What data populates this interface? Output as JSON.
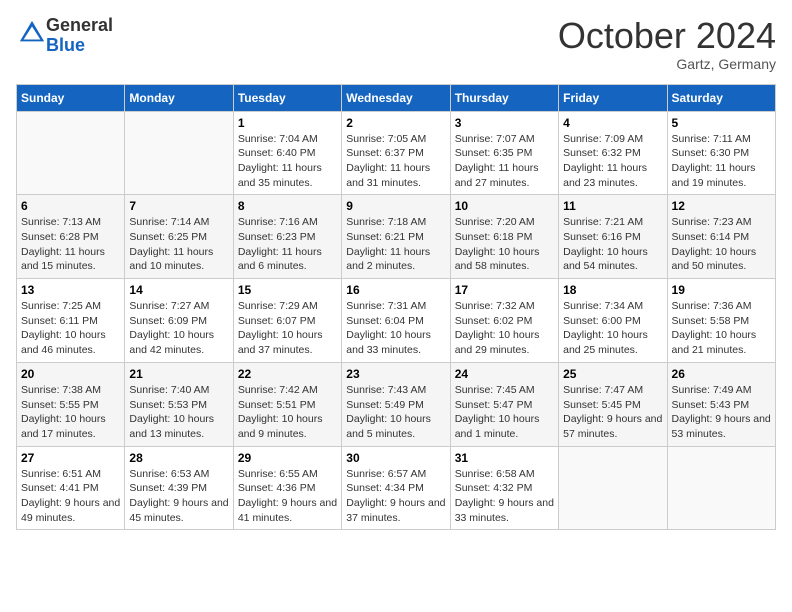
{
  "header": {
    "logo": {
      "general": "General",
      "blue": "Blue"
    },
    "title": "October 2024",
    "location": "Gartz, Germany"
  },
  "weekdays": [
    "Sunday",
    "Monday",
    "Tuesday",
    "Wednesday",
    "Thursday",
    "Friday",
    "Saturday"
  ],
  "weeks": [
    [
      {
        "day": "",
        "empty": true
      },
      {
        "day": "",
        "empty": true
      },
      {
        "day": "1",
        "sunrise": "Sunrise: 7:04 AM",
        "sunset": "Sunset: 6:40 PM",
        "daylight": "Daylight: 11 hours and 35 minutes."
      },
      {
        "day": "2",
        "sunrise": "Sunrise: 7:05 AM",
        "sunset": "Sunset: 6:37 PM",
        "daylight": "Daylight: 11 hours and 31 minutes."
      },
      {
        "day": "3",
        "sunrise": "Sunrise: 7:07 AM",
        "sunset": "Sunset: 6:35 PM",
        "daylight": "Daylight: 11 hours and 27 minutes."
      },
      {
        "day": "4",
        "sunrise": "Sunrise: 7:09 AM",
        "sunset": "Sunset: 6:32 PM",
        "daylight": "Daylight: 11 hours and 23 minutes."
      },
      {
        "day": "5",
        "sunrise": "Sunrise: 7:11 AM",
        "sunset": "Sunset: 6:30 PM",
        "daylight": "Daylight: 11 hours and 19 minutes."
      }
    ],
    [
      {
        "day": "6",
        "sunrise": "Sunrise: 7:13 AM",
        "sunset": "Sunset: 6:28 PM",
        "daylight": "Daylight: 11 hours and 15 minutes."
      },
      {
        "day": "7",
        "sunrise": "Sunrise: 7:14 AM",
        "sunset": "Sunset: 6:25 PM",
        "daylight": "Daylight: 11 hours and 10 minutes."
      },
      {
        "day": "8",
        "sunrise": "Sunrise: 7:16 AM",
        "sunset": "Sunset: 6:23 PM",
        "daylight": "Daylight: 11 hours and 6 minutes."
      },
      {
        "day": "9",
        "sunrise": "Sunrise: 7:18 AM",
        "sunset": "Sunset: 6:21 PM",
        "daylight": "Daylight: 11 hours and 2 minutes."
      },
      {
        "day": "10",
        "sunrise": "Sunrise: 7:20 AM",
        "sunset": "Sunset: 6:18 PM",
        "daylight": "Daylight: 10 hours and 58 minutes."
      },
      {
        "day": "11",
        "sunrise": "Sunrise: 7:21 AM",
        "sunset": "Sunset: 6:16 PM",
        "daylight": "Daylight: 10 hours and 54 minutes."
      },
      {
        "day": "12",
        "sunrise": "Sunrise: 7:23 AM",
        "sunset": "Sunset: 6:14 PM",
        "daylight": "Daylight: 10 hours and 50 minutes."
      }
    ],
    [
      {
        "day": "13",
        "sunrise": "Sunrise: 7:25 AM",
        "sunset": "Sunset: 6:11 PM",
        "daylight": "Daylight: 10 hours and 46 minutes."
      },
      {
        "day": "14",
        "sunrise": "Sunrise: 7:27 AM",
        "sunset": "Sunset: 6:09 PM",
        "daylight": "Daylight: 10 hours and 42 minutes."
      },
      {
        "day": "15",
        "sunrise": "Sunrise: 7:29 AM",
        "sunset": "Sunset: 6:07 PM",
        "daylight": "Daylight: 10 hours and 37 minutes."
      },
      {
        "day": "16",
        "sunrise": "Sunrise: 7:31 AM",
        "sunset": "Sunset: 6:04 PM",
        "daylight": "Daylight: 10 hours and 33 minutes."
      },
      {
        "day": "17",
        "sunrise": "Sunrise: 7:32 AM",
        "sunset": "Sunset: 6:02 PM",
        "daylight": "Daylight: 10 hours and 29 minutes."
      },
      {
        "day": "18",
        "sunrise": "Sunrise: 7:34 AM",
        "sunset": "Sunset: 6:00 PM",
        "daylight": "Daylight: 10 hours and 25 minutes."
      },
      {
        "day": "19",
        "sunrise": "Sunrise: 7:36 AM",
        "sunset": "Sunset: 5:58 PM",
        "daylight": "Daylight: 10 hours and 21 minutes."
      }
    ],
    [
      {
        "day": "20",
        "sunrise": "Sunrise: 7:38 AM",
        "sunset": "Sunset: 5:55 PM",
        "daylight": "Daylight: 10 hours and 17 minutes."
      },
      {
        "day": "21",
        "sunrise": "Sunrise: 7:40 AM",
        "sunset": "Sunset: 5:53 PM",
        "daylight": "Daylight: 10 hours and 13 minutes."
      },
      {
        "day": "22",
        "sunrise": "Sunrise: 7:42 AM",
        "sunset": "Sunset: 5:51 PM",
        "daylight": "Daylight: 10 hours and 9 minutes."
      },
      {
        "day": "23",
        "sunrise": "Sunrise: 7:43 AM",
        "sunset": "Sunset: 5:49 PM",
        "daylight": "Daylight: 10 hours and 5 minutes."
      },
      {
        "day": "24",
        "sunrise": "Sunrise: 7:45 AM",
        "sunset": "Sunset: 5:47 PM",
        "daylight": "Daylight: 10 hours and 1 minute."
      },
      {
        "day": "25",
        "sunrise": "Sunrise: 7:47 AM",
        "sunset": "Sunset: 5:45 PM",
        "daylight": "Daylight: 9 hours and 57 minutes."
      },
      {
        "day": "26",
        "sunrise": "Sunrise: 7:49 AM",
        "sunset": "Sunset: 5:43 PM",
        "daylight": "Daylight: 9 hours and 53 minutes."
      }
    ],
    [
      {
        "day": "27",
        "sunrise": "Sunrise: 6:51 AM",
        "sunset": "Sunset: 4:41 PM",
        "daylight": "Daylight: 9 hours and 49 minutes."
      },
      {
        "day": "28",
        "sunrise": "Sunrise: 6:53 AM",
        "sunset": "Sunset: 4:39 PM",
        "daylight": "Daylight: 9 hours and 45 minutes."
      },
      {
        "day": "29",
        "sunrise": "Sunrise: 6:55 AM",
        "sunset": "Sunset: 4:36 PM",
        "daylight": "Daylight: 9 hours and 41 minutes."
      },
      {
        "day": "30",
        "sunrise": "Sunrise: 6:57 AM",
        "sunset": "Sunset: 4:34 PM",
        "daylight": "Daylight: 9 hours and 37 minutes."
      },
      {
        "day": "31",
        "sunrise": "Sunrise: 6:58 AM",
        "sunset": "Sunset: 4:32 PM",
        "daylight": "Daylight: 9 hours and 33 minutes."
      },
      {
        "day": "",
        "empty": true
      },
      {
        "day": "",
        "empty": true
      }
    ]
  ]
}
